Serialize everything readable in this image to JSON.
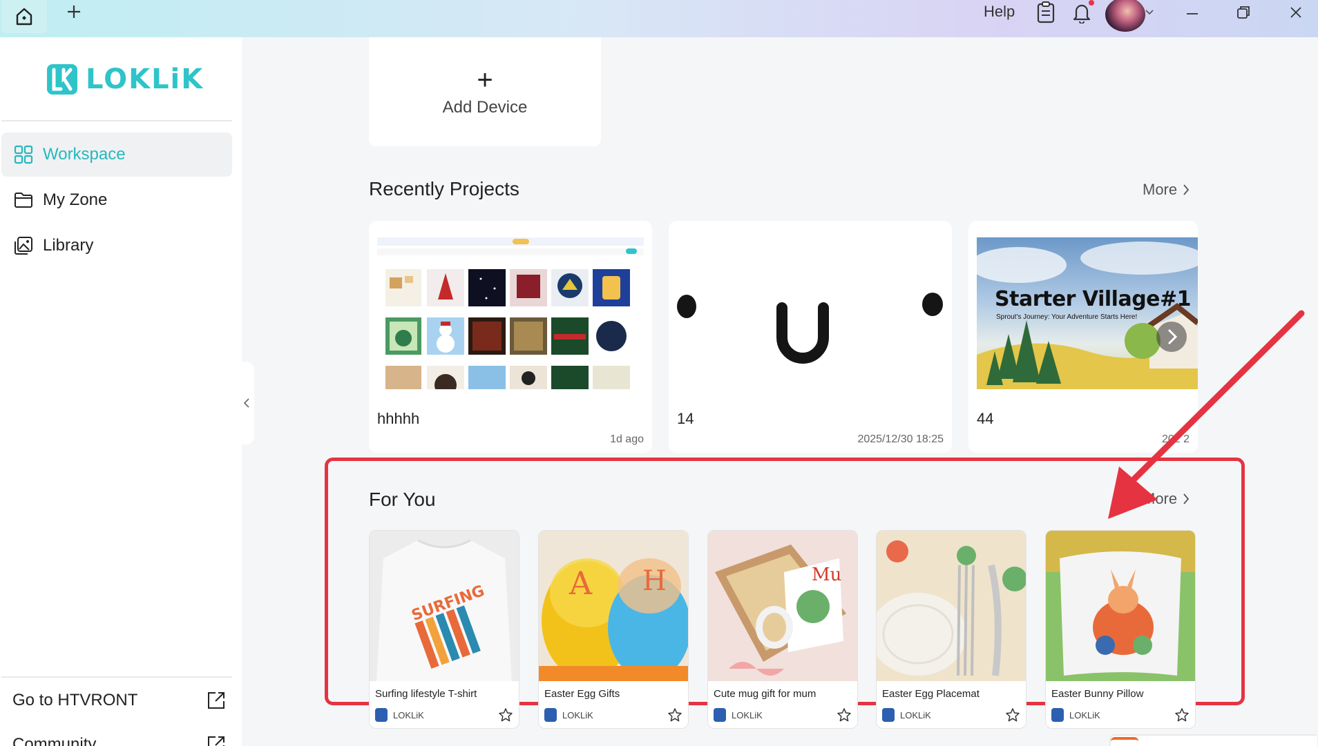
{
  "titlebar": {
    "help_label": "Help"
  },
  "brand": {
    "logo_text": "LOKLiK",
    "accent_color": "#2ec4c9"
  },
  "sidebar": {
    "items": [
      {
        "label": "Workspace",
        "icon": "grid-icon",
        "active": true
      },
      {
        "label": "My Zone",
        "icon": "folder-icon",
        "active": false
      },
      {
        "label": "Library",
        "icon": "gallery-icon",
        "active": false
      }
    ],
    "links": [
      {
        "label": "Go to HTVRONT",
        "icon": "external-link-icon"
      },
      {
        "label": "Community",
        "icon": "external-link-icon"
      }
    ]
  },
  "add_device": {
    "plus": "+",
    "label": "Add Device"
  },
  "recent": {
    "title": "Recently Projects",
    "more_label": "More",
    "projects": [
      {
        "name": "hhhhh",
        "date": "1d ago"
      },
      {
        "name": "14",
        "date": "2025/12/30 18:25"
      },
      {
        "name": "44",
        "date": "202  2",
        "thumb_title": "Starter Village#1",
        "thumb_subtitle": "Sprout's Journey: Your Adventure Starts Here!"
      }
    ]
  },
  "for_you": {
    "title": "For You",
    "more_label": "More",
    "highlight_color": "#e53342",
    "cards": [
      {
        "title": "Surfing lifestyle T-shirt",
        "brand": "LOKLiK"
      },
      {
        "title": "Easter Egg Gifts",
        "brand": "LOKLiK"
      },
      {
        "title": "Cute mug gift for mum",
        "brand": "LOKLiK"
      },
      {
        "title": "Easter Egg Placemat",
        "brand": "LOKLiK"
      },
      {
        "title": "Easter Bunny Pillow",
        "brand": "LOKLiK"
      }
    ]
  }
}
